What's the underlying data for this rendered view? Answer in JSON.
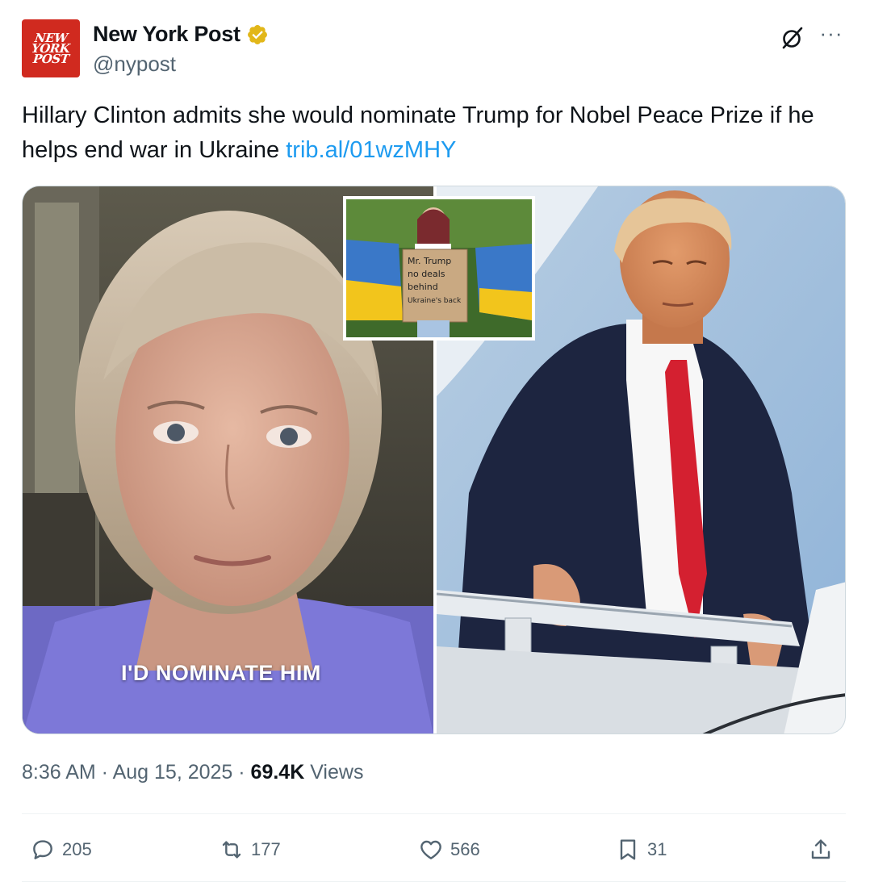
{
  "account": {
    "logo_lines": [
      "NEW",
      "YORK",
      "POST"
    ],
    "name": "New York Post",
    "handle": "@nypost",
    "verified_badge": "gold-verified-badge",
    "brand_color": "#d02a1f"
  },
  "tweet": {
    "text": "Hillary Clinton admits she would nominate Trump for Nobel Peace Prize if he helps end war in Ukraine ",
    "link": "trib.al/01wzMHY",
    "link_color": "#1d9bf0"
  },
  "media": {
    "left_caption": "I'D NOMINATE HIM",
    "inset_sign_lines": [
      "Mr. Trump",
      "no deals",
      "behind",
      "Ukraine's back"
    ]
  },
  "meta": {
    "time": "8:36 AM",
    "separator": " · ",
    "date": "Aug 15, 2025",
    "views_count": "69.4K",
    "views_label": " Views"
  },
  "actions": {
    "replies": "205",
    "reposts": "177",
    "likes": "566",
    "bookmarks": "31"
  },
  "icons": {
    "grok": "grok-icon",
    "more": "more-icon",
    "reply": "reply-icon",
    "repost": "repost-icon",
    "like": "heart-icon",
    "bookmark": "bookmark-icon",
    "share": "share-icon"
  }
}
